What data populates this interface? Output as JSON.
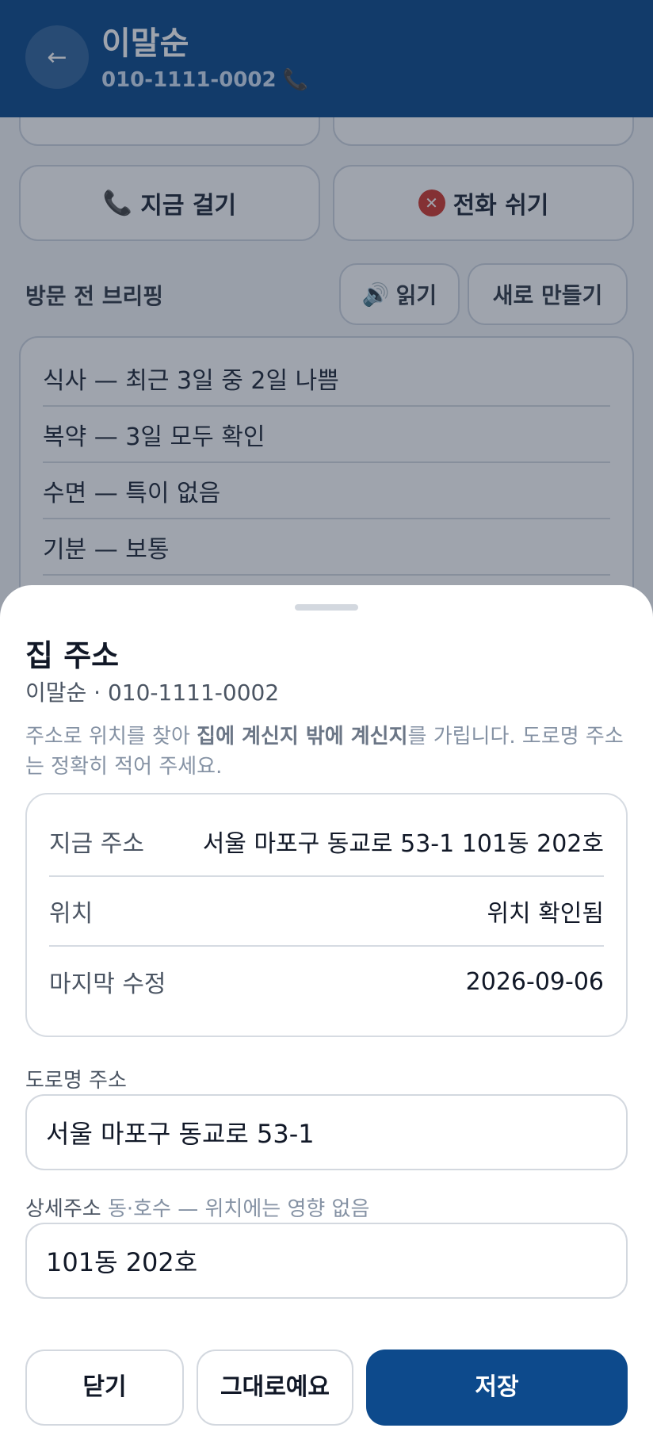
{
  "header": {
    "name": "이말순",
    "phone": "010-1111-0002",
    "back_glyph": "←",
    "phone_glyph": "📞"
  },
  "actions": {
    "call_now": "지금 걸기",
    "call_now_icon": "📞",
    "no_call": "전화 쉬기",
    "no_call_icon": "🔕"
  },
  "briefing": {
    "title": "방문 전 브리핑",
    "read_label": "읽기",
    "read_icon": "🔊",
    "regen_label": "새로 만들기",
    "items": [
      "식사 — 최근 3일 중 2일 나쁨",
      "복약 — 3일 모두 확인",
      "수면 — 특이 없음",
      "기분 — 보통"
    ]
  },
  "sheet": {
    "title": "집 주소",
    "subtitle": "이말순 · 010-1111-0002",
    "help_pre": "주소로 위치를 찾아 ",
    "help_bold": "집에 계신지 밖에 계신지",
    "help_post": "를 가립니다. 도로명 주소는 정확히 적어 주세요.",
    "rows": [
      {
        "label": "지금 주소",
        "value": "서울 마포구 동교로 53-1 101동 202호"
      },
      {
        "label": "위치",
        "value": "위치 확인됨"
      },
      {
        "label": "마지막 수정",
        "value": "2026-09-06"
      }
    ],
    "road_label": "도로명 주소",
    "road_value": "서울 마포구 동교로 53-1",
    "detail_label": "상세주소",
    "detail_hint": "동·호수 — 위치에는 영향 없음",
    "detail_value": "101동 202호",
    "close_label": "닫기",
    "keep_label": "그대로예요",
    "save_label": "저장"
  }
}
